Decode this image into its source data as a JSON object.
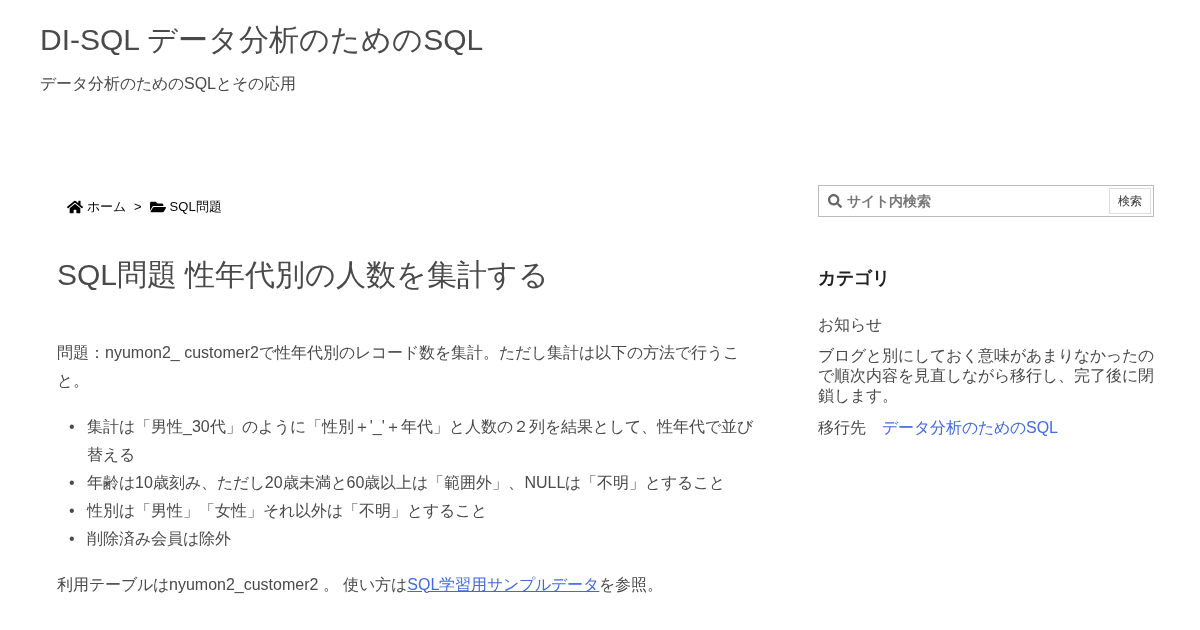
{
  "site": {
    "title": "DI-SQL データ分析のためのSQL",
    "tagline": "データ分析のためのSQLとその応用"
  },
  "breadcrumb": [
    {
      "kind": "home",
      "label": "ホーム"
    },
    {
      "kind": "separator",
      "label": ">"
    },
    {
      "kind": "folder",
      "label": "SQL問題"
    }
  ],
  "article": {
    "title": "SQL問題 性年代別の人数を集計する",
    "intro": "問題：nyumon2_ customer2で性年代別のレコード数を集計。ただし集計は以下の方法で行うこと。",
    "bullets": [
      {
        "marker": "•",
        "text": "集計は「男性_30代」のように「性別＋'_'＋年代」と人数の２列を結果として、性年代で並び替える"
      },
      {
        "marker": "•",
        "text": "年齢は10歳刻み、ただし20歳未満と60歳以上は「範囲外」、NULLは「不明」とすること"
      },
      {
        "marker": "•",
        "text": "性別は「男性」「女性」それ以外は「不明」とすること"
      },
      {
        "marker": "•",
        "text": "削除済み会員は除外"
      }
    ],
    "footer": {
      "before": "利用テーブルはnyumon2_customer2 。 使い方は",
      "link": "SQL学習用サンプルデータ",
      "after": "を参照。"
    }
  },
  "sidebar": {
    "search": {
      "placeholder": "サイト内検索",
      "button": "検索"
    },
    "category_heading": "カテゴリ",
    "category": "お知らせ",
    "notice": "ブログと別にしておく意味があまりなかったので順次内容を見直しながら移行し、完了後に閉鎖します。",
    "move": {
      "label": "移行先",
      "link": "データ分析のためのSQL"
    }
  }
}
